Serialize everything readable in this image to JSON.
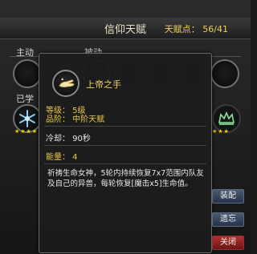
{
  "header": {
    "title": "信仰天赋",
    "talent_points": "天赋点： 56/41"
  },
  "sections": {
    "active": "主动",
    "passive": "被动",
    "learned": "已学"
  },
  "tooltip": {
    "skill_name": "上帝之手",
    "level": "等级： 5级",
    "grade": "品阶： 中阶天赋",
    "cooldown": "冷却： 90秒",
    "energy": "能量： 4",
    "description": "祈祷生命女神，5轮内持续恢复7x7范围内队友及自己的异兽，每轮恢复[魔击x5]生命值。",
    "icon": "hand-icon"
  },
  "buttons": {
    "equip": "装配",
    "forget": "遗忘",
    "close": "关闭"
  },
  "skill_icons": {
    "row2_first": "snowflake-icon",
    "row2_last": "crown-icon"
  }
}
